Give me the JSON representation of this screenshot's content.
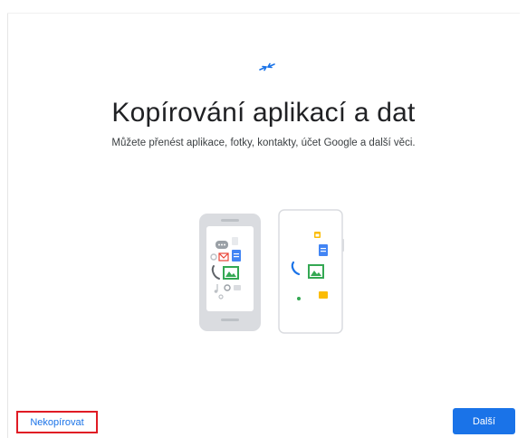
{
  "window": {
    "title": "Kopírování aplikací a dat",
    "subtitle": "Můžete přenést aplikace, fotky, kontakty, účet Google a další věci."
  },
  "icons": {
    "header": "transfer-arrows-icon",
    "illustration": "two-phones-data-transfer-illustration"
  },
  "actions": {
    "skip_label": "Nekopírovat",
    "next_label": "Další"
  },
  "colors": {
    "accent": "#1a73e8",
    "highlight_border": "#e01b24",
    "title_text": "#202124"
  }
}
